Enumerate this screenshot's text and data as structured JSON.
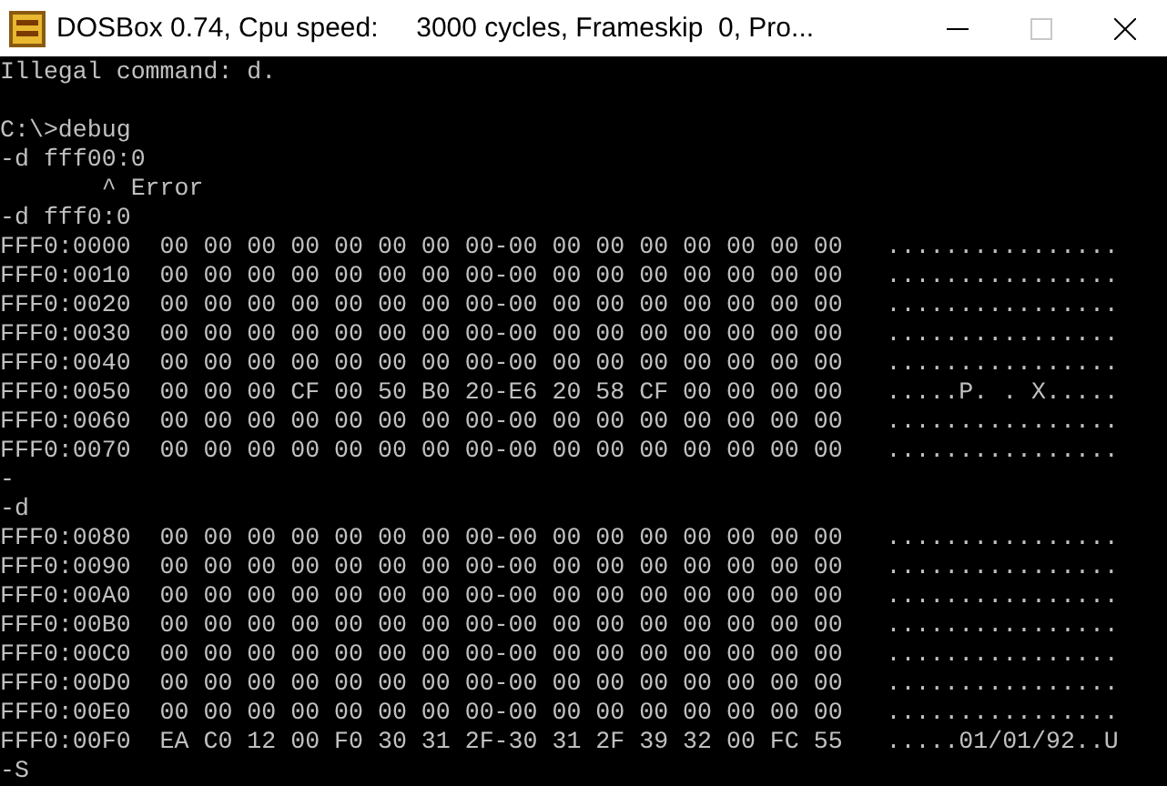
{
  "window": {
    "title": "DOSBox 0.74, Cpu speed:     3000 cycles, Frameskip  0, Pro...",
    "controls": [
      {
        "kind": "minimize",
        "disabled": false
      },
      {
        "kind": "maximize",
        "disabled": true
      },
      {
        "kind": "close",
        "disabled": false
      }
    ]
  },
  "terminal": {
    "blocks": [
      {
        "lines": [
          "Illegal command: d."
        ]
      },
      {
        "lines": [
          "C:\\>debug",
          "-d fff00:0",
          "       ^ Error",
          "-d fff0:0",
          "FFF0:0000  00 00 00 00 00 00 00 00-00 00 00 00 00 00 00 00   ................",
          "FFF0:0010  00 00 00 00 00 00 00 00-00 00 00 00 00 00 00 00   ................",
          "FFF0:0020  00 00 00 00 00 00 00 00-00 00 00 00 00 00 00 00   ................",
          "FFF0:0030  00 00 00 00 00 00 00 00-00 00 00 00 00 00 00 00   ................",
          "FFF0:0040  00 00 00 00 00 00 00 00-00 00 00 00 00 00 00 00   ................",
          "FFF0:0050  00 00 00 CF 00 50 B0 20-E6 20 58 CF 00 00 00 00   .....P. . X.....",
          "FFF0:0060  00 00 00 00 00 00 00 00-00 00 00 00 00 00 00 00   ................",
          "FFF0:0070  00 00 00 00 00 00 00 00-00 00 00 00 00 00 00 00   ................",
          "-",
          "-d",
          "FFF0:0080  00 00 00 00 00 00 00 00-00 00 00 00 00 00 00 00   ................",
          "FFF0:0090  00 00 00 00 00 00 00 00-00 00 00 00 00 00 00 00   ................",
          "FFF0:00A0  00 00 00 00 00 00 00 00-00 00 00 00 00 00 00 00   ................",
          "FFF0:00B0  00 00 00 00 00 00 00 00-00 00 00 00 00 00 00 00   ................",
          "FFF0:00C0  00 00 00 00 00 00 00 00-00 00 00 00 00 00 00 00   ................",
          "FFF0:00D0  00 00 00 00 00 00 00 00-00 00 00 00 00 00 00 00   ................",
          "FFF0:00E0  00 00 00 00 00 00 00 00-00 00 00 00 00 00 00 00   ................",
          "FFF0:00F0  EA C0 12 00 F0 30 31 2F-30 31 2F 39 32 00 FC 55   .....01/01/92..U",
          "-S"
        ]
      }
    ]
  }
}
